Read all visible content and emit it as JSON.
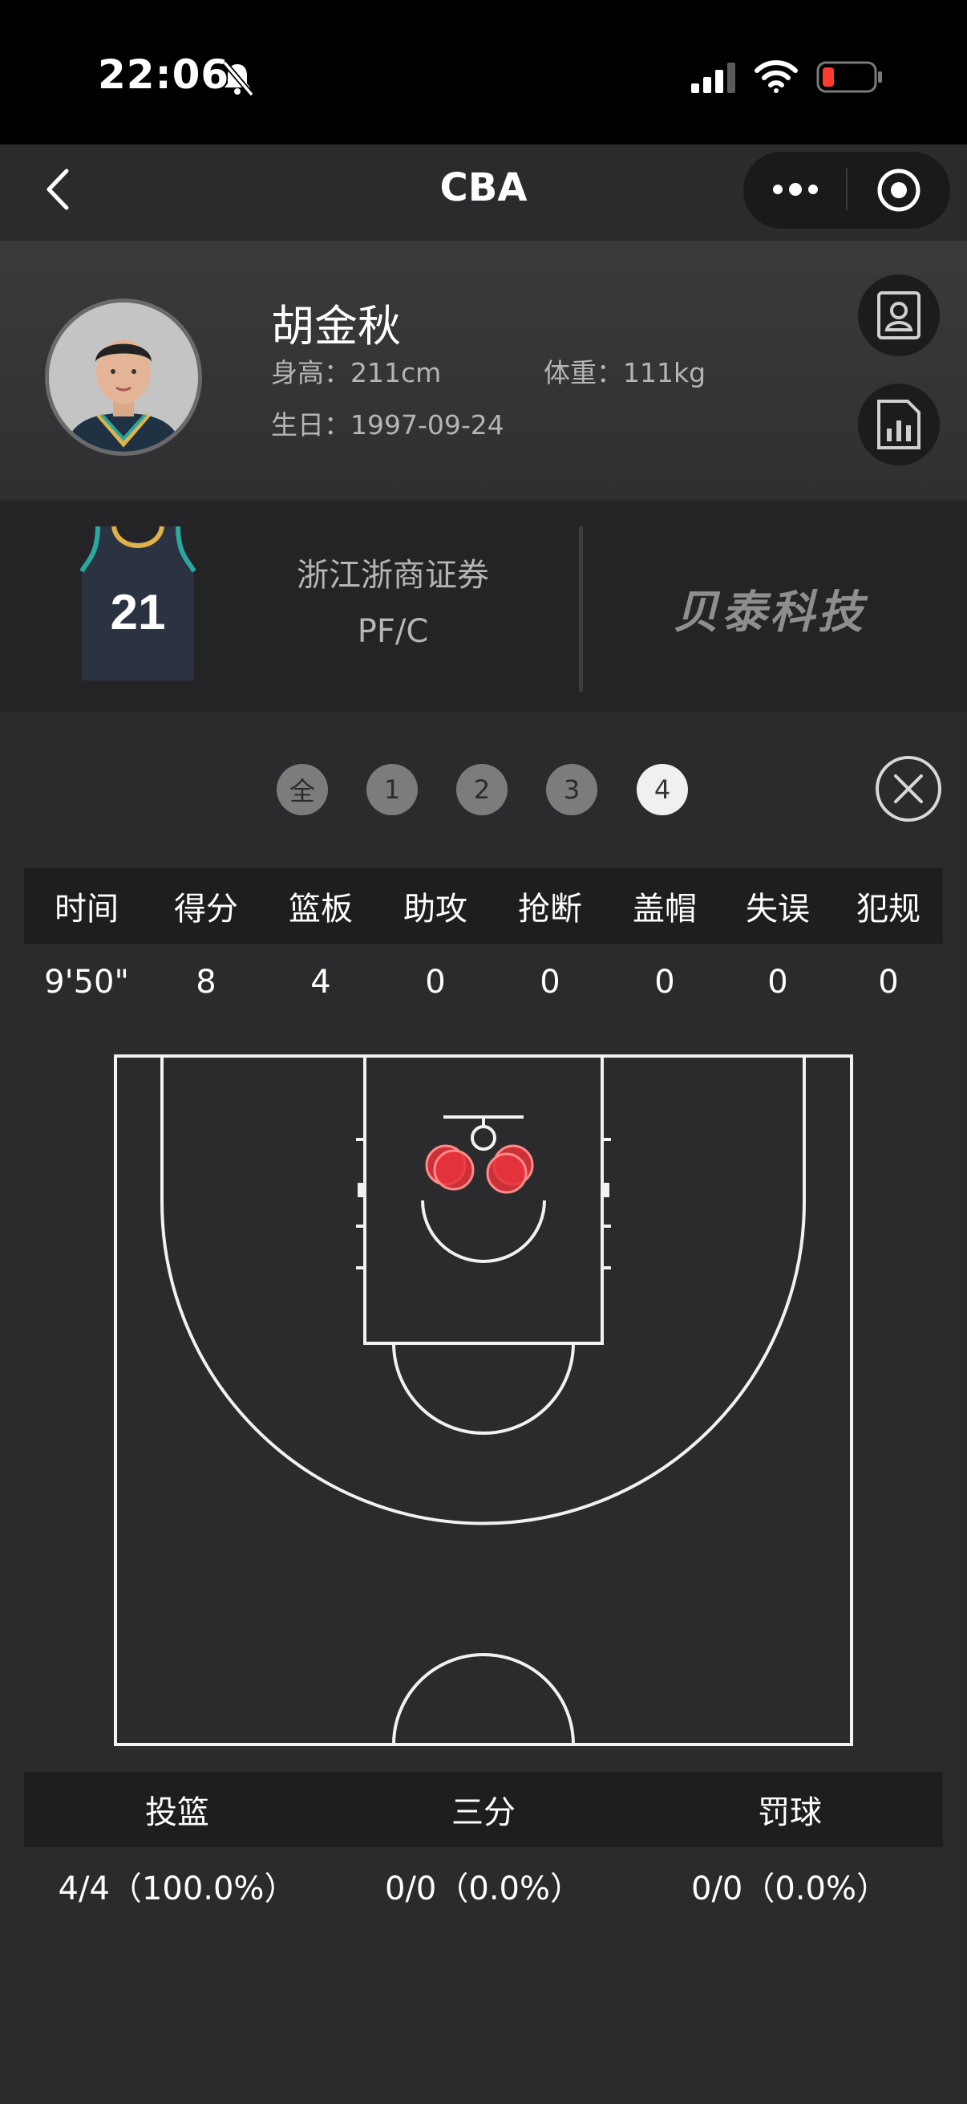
{
  "status_bar": {
    "time": "22:06"
  },
  "nav": {
    "title": "CBA"
  },
  "player": {
    "name": "胡金秋",
    "height": "身高：211cm",
    "weight": "体重：111kg",
    "birthday": "生日：1997-09-24"
  },
  "team": {
    "jersey_number": "21",
    "name": "浙江浙商证券",
    "position": "PF/C",
    "sponsor": "贝泰科技"
  },
  "quarters": {
    "items": [
      "全",
      "1",
      "2",
      "3",
      "4"
    ],
    "selected": "4"
  },
  "stats": {
    "headers": [
      "时间",
      "得分",
      "篮板",
      "助攻",
      "抢断",
      "盖帽",
      "失误",
      "犯规"
    ],
    "values": [
      "9'50\"",
      "8",
      "4",
      "0",
      "0",
      "0",
      "0",
      "0"
    ]
  },
  "shooting": {
    "headers": [
      "投篮",
      "三分",
      "罚球"
    ],
    "values": [
      "4/4（100.0%）",
      "0/0（0.0%）",
      "0/0（0.0%）"
    ]
  },
  "shot_chart": {
    "made_shots": 4,
    "shot_color": "#e8323c"
  },
  "colors": {
    "background": "#2b2b2d",
    "header_band": "#1e1e20",
    "chip_selected": "#f0f0f0",
    "chip_default": "#7c7c7c"
  }
}
